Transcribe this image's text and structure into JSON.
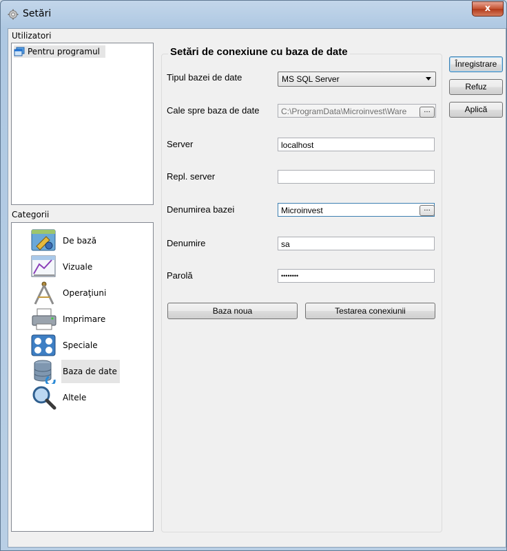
{
  "window": {
    "title": "Setări",
    "close_label": "x"
  },
  "users": {
    "group_label": "Utilizatori",
    "items": [
      {
        "label": "Pentru programul",
        "icon": "windows-stack-icon"
      }
    ]
  },
  "categories": {
    "group_label": "Categorii",
    "selected": "Baza de date",
    "items": [
      {
        "label": "De bază",
        "icon": "basic-settings-icon"
      },
      {
        "label": "Vizuale",
        "icon": "visual-chart-icon"
      },
      {
        "label": "Operaţiuni",
        "icon": "drawing-compass-icon"
      },
      {
        "label": "Imprimare",
        "icon": "printer-icon"
      },
      {
        "label": "Speciale",
        "icon": "special-gauges-icon"
      },
      {
        "label": "Baza de date",
        "icon": "database-icon"
      },
      {
        "label": "Altele",
        "icon": "magnifier-icon"
      }
    ]
  },
  "connection": {
    "title": "Setări de conexiune cu baza de date",
    "db_type": {
      "label": "Tipul bazei de date",
      "value": "MS SQL Server"
    },
    "db_path": {
      "label": "Cale spre baza de date",
      "value": "C:\\ProgramData\\Microinvest\\Ware",
      "button": "..."
    },
    "server": {
      "label": "Server",
      "value": "localhost"
    },
    "repl_server": {
      "label": "Repl. server",
      "value": ""
    },
    "db_name": {
      "label": "Denumirea bazei",
      "value": "Microinvest",
      "button": "..."
    },
    "username": {
      "label": "Denumire",
      "value": "sa"
    },
    "password": {
      "label": "Parolă",
      "value": "••••••••"
    },
    "new_db_button": "Baza noua",
    "test_button": "Testarea conexiunii"
  },
  "actions": {
    "save": "Înregistrare",
    "cancel": "Refuz",
    "apply": "Aplică"
  }
}
